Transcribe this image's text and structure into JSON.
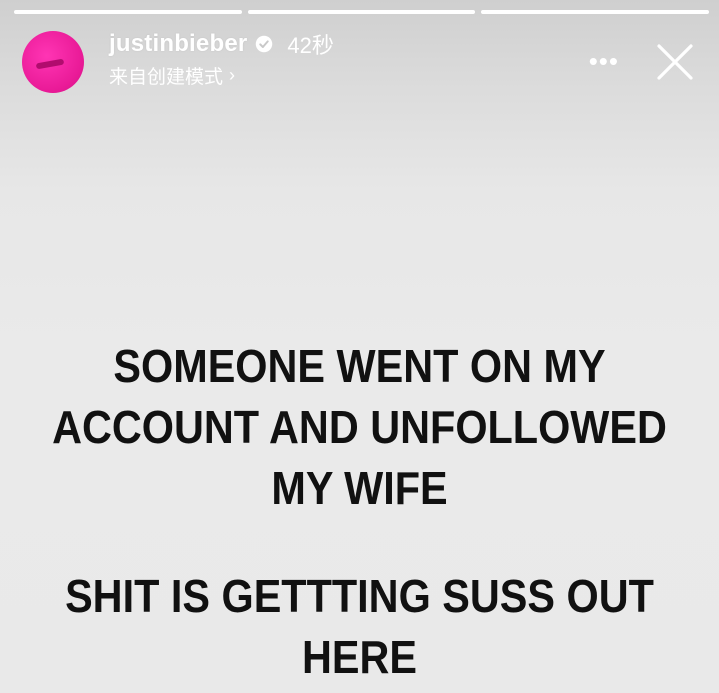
{
  "story": {
    "progress": [
      {
        "fraction": 1.0
      },
      {
        "fraction": 1.0
      },
      {
        "fraction": 1.0
      }
    ],
    "username": "justinbieber",
    "verified": true,
    "time_ago": "42秒",
    "source_label": "来自创建模式",
    "text_block_1": {
      "line1": "SOMEONE WENT ON MY",
      "line2": "ACCOUNT AND UNFOLLOWED",
      "line3": "MY WIFE"
    },
    "text_block_2": {
      "line1": "SHIT IS GETTTING SUSS OUT",
      "line2": "HERE"
    },
    "colors": {
      "avatar": "#ea1b98",
      "text": "#111111",
      "header_text": "#ffffff"
    },
    "icons": {
      "verified": "verified-icon",
      "more": "more-icon",
      "close": "close-icon",
      "chevron": "chevron-right-icon"
    }
  }
}
